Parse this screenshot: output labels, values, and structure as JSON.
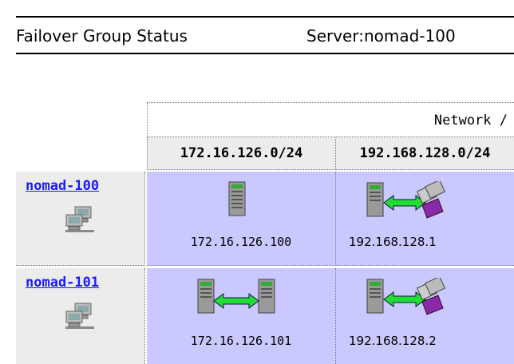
{
  "header": {
    "title": "Failover Group Status",
    "server": "Server:nomad-100"
  },
  "table": {
    "network_label": "Network /",
    "subnets": [
      "172.16.126.0/24",
      "192.168.128.0/24"
    ],
    "rows": [
      {
        "host": "nomad-100",
        "cells": [
          {
            "ip": "172.16.126.100",
            "icon": "server-icon"
          },
          {
            "ip": "192.168.128.1",
            "icon": "server-network-link-icon"
          }
        ]
      },
      {
        "host": "nomad-101",
        "cells": [
          {
            "ip": "172.16.126.101",
            "icon": "server-to-server-link-icon"
          },
          {
            "ip": "192.168.128.2",
            "icon": "server-network-link-icon"
          }
        ]
      }
    ]
  },
  "colors": {
    "interface_cell": "#c9c9ff",
    "header_cell": "#ececec",
    "link": "#1a1aff",
    "arrow": "#22dd33"
  }
}
